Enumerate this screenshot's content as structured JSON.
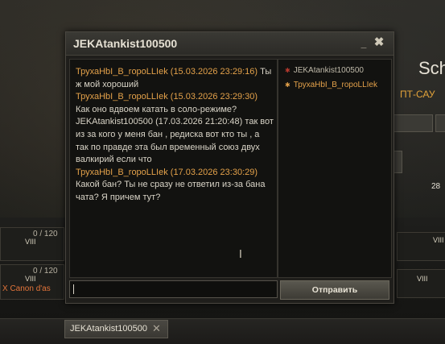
{
  "background": {
    "left_counters": [
      "0 / 120",
      "0 / 120"
    ],
    "left_tier_labels": [
      "VIII",
      "VIII"
    ],
    "left_vehicle_text": "X Canon d'as",
    "right_title": "Sch",
    "right_subtitle": "ПТ-САУ",
    "right_number": "28",
    "right_tier_labels": [
      "VIII",
      "VIII"
    ]
  },
  "chat_window": {
    "title": "JEKAtankist100500",
    "min_symbol": "_",
    "close_symbol": "✖",
    "messages": [
      {
        "sender": "ТрухаHbI_B_ropoLLIek",
        "timestamp": "(15.03.2026 23:29:16)",
        "text": "Ты ж мой хороший",
        "color": "orange"
      },
      {
        "sender": "ТрухаHbI_B_ropoLLIek",
        "timestamp": "(15.03.2026 23:29:30)",
        "text": "Как оно вдвоем катать в соло-режиме?",
        "color": "orange"
      },
      {
        "sender": "JEKAtankist100500",
        "timestamp": "(17.03.2026 21:20:48)",
        "text": "так вот из за кого у меня бан , редиска вот кто ты , а так по правде эта был временный союз двух валкирий если что",
        "color": "white"
      },
      {
        "sender": "ТрухаHbI_B_ropoLLIek",
        "timestamp": "(17.03.2026 23:30:29)",
        "text": "Какой бан? Ты не сразу не ответил из-за бана чата? Я причем тут?",
        "color": "orange"
      }
    ],
    "members": [
      {
        "name": "JEKAtankist100500",
        "status_color": "#b83a2e"
      },
      {
        "name": "ТрухаHbI_B_ropoLLIek",
        "status_color": "#e3a14a"
      }
    ],
    "input": {
      "value": "",
      "placeholder": ""
    },
    "send_label": "Отправить"
  },
  "taskbar": {
    "tab_label": "JEKAtankist100500",
    "tab_close": "✕"
  }
}
